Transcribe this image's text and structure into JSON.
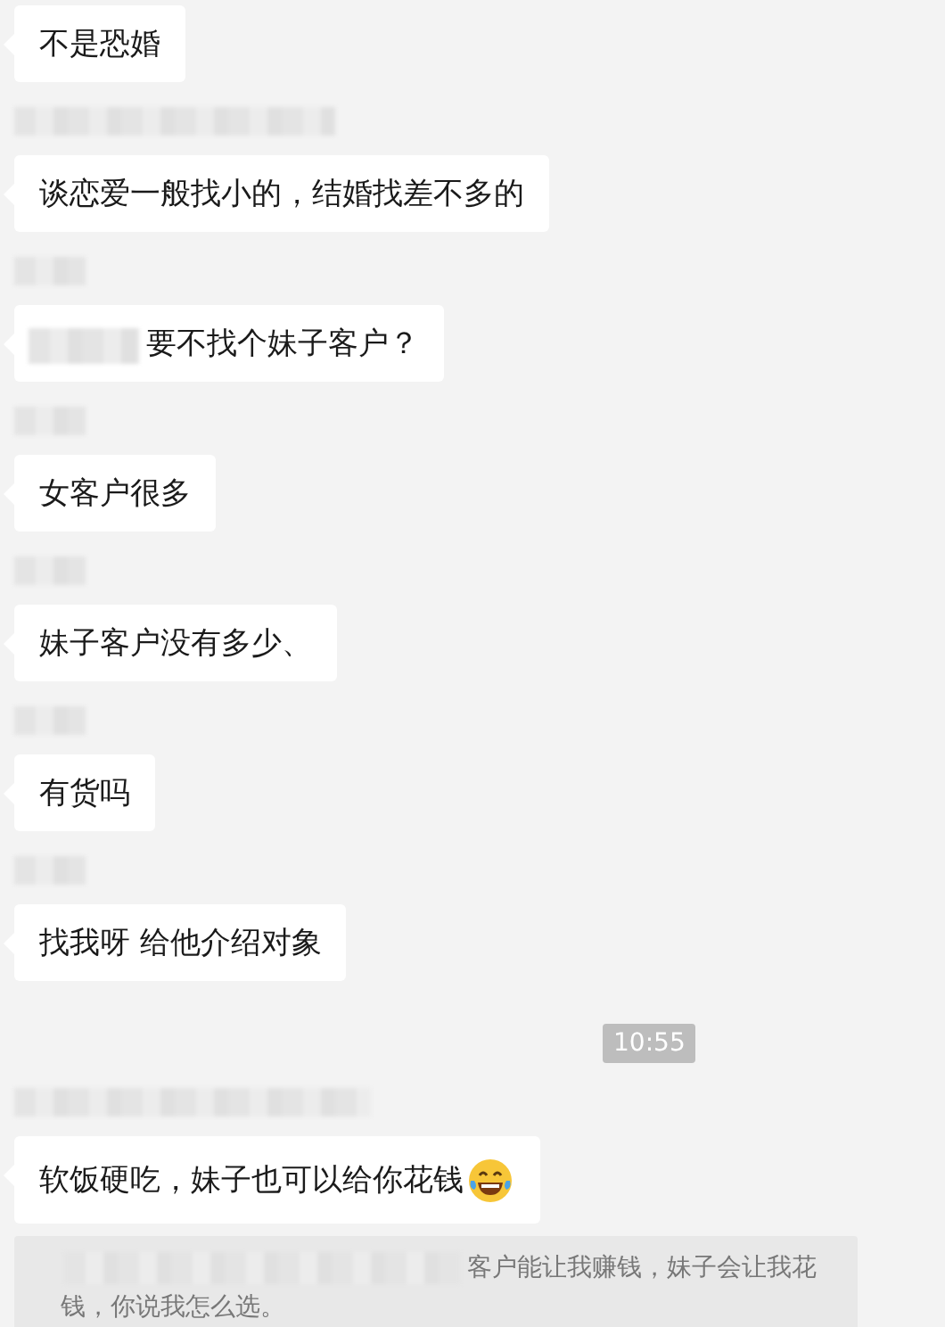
{
  "messages": [
    {
      "kind": "text",
      "text": "不是恐婚"
    },
    {
      "kind": "text",
      "text": "谈恋爱一般找小的，结婚找差不多的"
    },
    {
      "kind": "mention",
      "text": "要不找个妹子客户？"
    },
    {
      "kind": "text",
      "text": "女客户很多"
    },
    {
      "kind": "text",
      "text": "妹子客户没有多少、"
    },
    {
      "kind": "text",
      "text": "有货吗"
    },
    {
      "kind": "text",
      "text": "找我呀  给他介绍对象"
    },
    {
      "kind": "time",
      "text": "10:55"
    },
    {
      "kind": "emoji",
      "text": "软饭硬吃，妹子也可以给你花钱"
    },
    {
      "kind": "quote",
      "lines": [
        "客户能让我赚钱，妹子会让我花",
        "钱，你说我怎么选。"
      ]
    }
  ]
}
